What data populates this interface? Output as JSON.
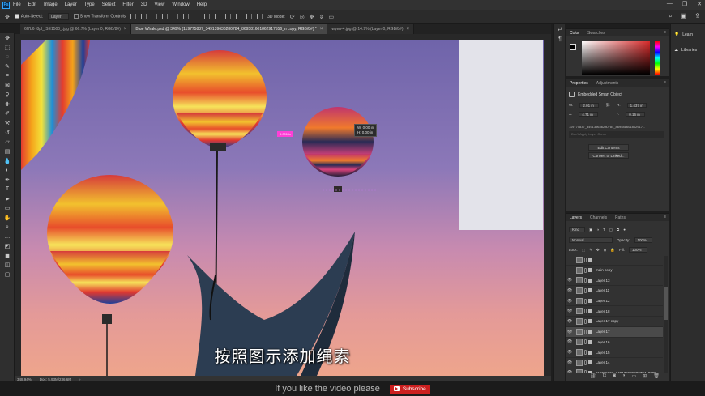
{
  "menubar": {
    "items": [
      "File",
      "Edit",
      "Image",
      "Layer",
      "Type",
      "Select",
      "Filter",
      "3D",
      "View",
      "Window",
      "Help"
    ],
    "window_controls": [
      "—",
      "❐",
      "✕"
    ]
  },
  "options": {
    "auto_select_label": "Auto-Select:",
    "auto_select_value": "Layer",
    "show_transform_label": "Show Transform Controls",
    "mode_3d": "3D Mode:"
  },
  "tabs": [
    {
      "label": "6f7b6~8pl_ SE1500_.jpg @ 66.7% (Layer 0, RGB/8#)",
      "active": false
    },
    {
      "label": "Blue Whale.psd @ 349% (119775837_349139636280784_869581601862917556_n copy, RGB/8#) *",
      "active": true
    },
    {
      "label": "wyen-4.jpg @ 14.9% (Layer 0, RGB/8#)",
      "active": false
    }
  ],
  "status": {
    "zoom": "348.94%",
    "doc": "Doc: 5.93M/236.6M"
  },
  "canvas": {
    "transform_readout_w": "W: 0.00 in",
    "transform_readout_h": "H: 0.00 in",
    "pink_tag": "0.001 in"
  },
  "color_panel": {
    "tabs": [
      "Color",
      "Swatches"
    ]
  },
  "properties": {
    "tabs": [
      "Properties",
      "Adjustments"
    ],
    "title": "Embedded Smart Object",
    "w_label": "W:",
    "w_value": "2.01 in",
    "h_label": "H:",
    "h_value": "1.437 in",
    "x_label": "X:",
    "x_value": "4.71 in",
    "y_label": "Y:",
    "y_value": "0.16 in",
    "path": "119775837_349139636280784_869581601862917...",
    "placeholder": "Don't Apply Layer Comp",
    "edit_contents": "Edit Contents",
    "convert_linked": "Convert to Linked..."
  },
  "layers": {
    "tabs": [
      "Layers",
      "Channels",
      "Paths"
    ],
    "filter_kind": "Kind",
    "blend_mode": "Normal",
    "opacity_label": "Opacity:",
    "opacity_value": "100%",
    "lock_label": "Lock:",
    "fill_label": "Fill:",
    "fill_value": "100%",
    "rows": [
      {
        "name": "",
        "visible": false,
        "selected": false
      },
      {
        "name": "main copy",
        "visible": false,
        "selected": false
      },
      {
        "name": "Layer 13",
        "visible": true,
        "selected": false
      },
      {
        "name": "Layer 11",
        "visible": true,
        "selected": false
      },
      {
        "name": "Layer 12",
        "visible": true,
        "selected": false
      },
      {
        "name": "Layer 18",
        "visible": true,
        "selected": false
      },
      {
        "name": "Layer 17 copy",
        "visible": true,
        "selected": false
      },
      {
        "name": "Layer 17",
        "visible": true,
        "selected": true
      },
      {
        "name": "Layer 16",
        "visible": true,
        "selected": false
      },
      {
        "name": "Layer 15",
        "visible": true,
        "selected": false
      },
      {
        "name": "Layer 14",
        "visible": true,
        "selected": false
      },
      {
        "name": "119775837_349139636280784_8695...",
        "visible": true,
        "selected": false
      }
    ]
  },
  "far_right": {
    "learn": "Learn",
    "libraries": "Libraries"
  },
  "subtitle": "按照图示添加绳索",
  "bottom": {
    "promo": "If you like the video please",
    "subscribe": "Subscribe"
  }
}
